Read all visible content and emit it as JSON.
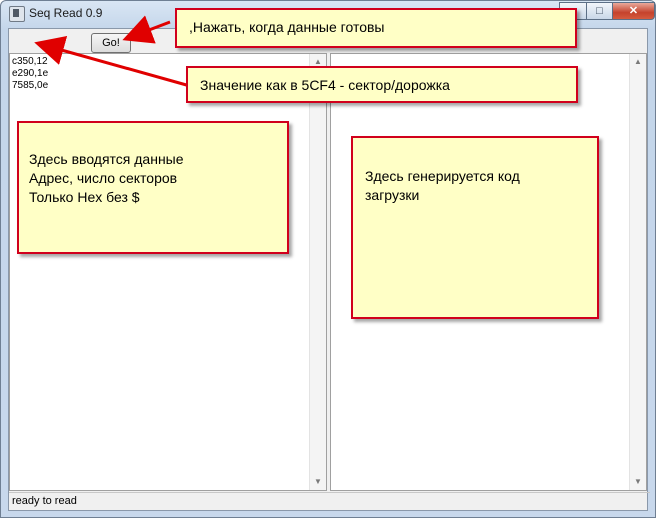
{
  "window": {
    "title": "Seq Read 0.9",
    "buttons": {
      "minimize": "–",
      "maximize": "□",
      "close": "✕"
    }
  },
  "toolbar": {
    "go_label": "Go!"
  },
  "left_pane": {
    "lines": [
      "c350,12",
      "e290,1e",
      "7585,0e"
    ]
  },
  "right_pane": {
    "lines": []
  },
  "status_bar": {
    "text": "ready to read"
  },
  "callouts": {
    "go_hint": ",Нажать, когда данные готовы",
    "value_hint": "Значение как в 5CF4 - сектор/дорожка",
    "input_hint": "Здесь вводятся данные\nАдрес, число секторов\nТолько Hex без $",
    "output_hint": "Здесь генерируется код\nзагрузки"
  },
  "colors": {
    "callout_fill": "#ffffc6",
    "callout_border": "#d1001c",
    "arrow": "#e00000"
  }
}
